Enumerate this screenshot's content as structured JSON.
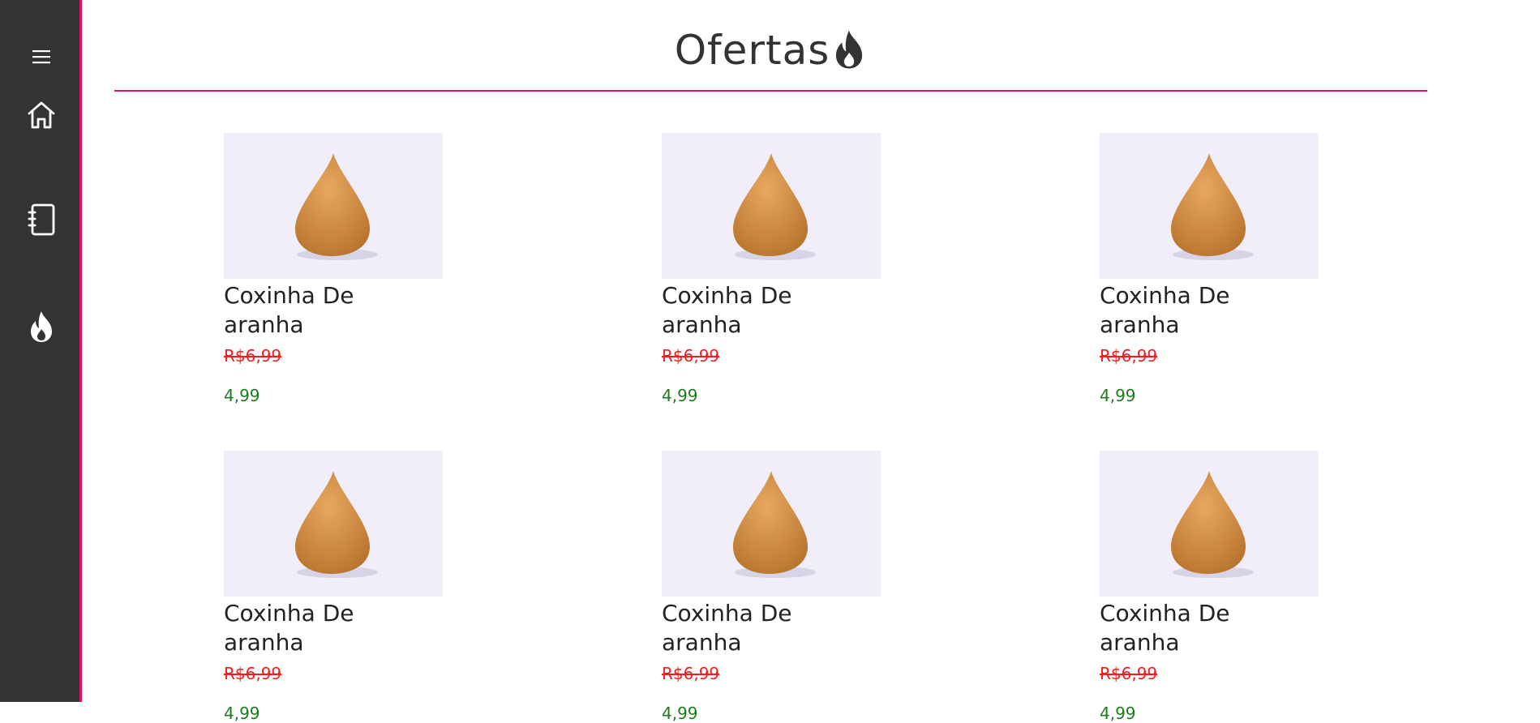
{
  "sidebar": {
    "items": [
      {
        "name": "menu",
        "icon": "hamburger-menu-icon"
      },
      {
        "name": "home",
        "icon": "home-icon"
      },
      {
        "name": "orders",
        "icon": "notebook-icon"
      },
      {
        "name": "offers",
        "icon": "flame-icon"
      }
    ]
  },
  "colors": {
    "sidebar_bg": "#353331",
    "accent": "#e5116d",
    "old_price": "#f01e1e",
    "new_price": "#1f7a1f"
  },
  "page": {
    "title": "Ofertas",
    "title_icon": "flame-icon"
  },
  "products": [
    {
      "name": "Coxinha De aranha",
      "old_price": "R$6,99",
      "new_price": "4,99"
    },
    {
      "name": "Coxinha De aranha",
      "old_price": "R$6,99",
      "new_price": "4,99"
    },
    {
      "name": "Coxinha De aranha",
      "old_price": "R$6,99",
      "new_price": "4,99"
    },
    {
      "name": "Coxinha De aranha",
      "old_price": "R$6,99",
      "new_price": "4,99"
    },
    {
      "name": "Coxinha De aranha",
      "old_price": "R$6,99",
      "new_price": "4,99"
    },
    {
      "name": "Coxinha De aranha",
      "old_price": "R$6,99",
      "new_price": "4,99"
    }
  ]
}
